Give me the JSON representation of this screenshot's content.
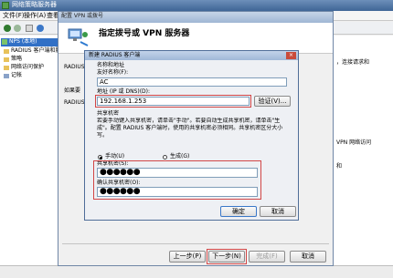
{
  "main_window": {
    "title": "网络策略服务器"
  },
  "menu": [
    "文件(F)",
    "操作(A)",
    "查看(V)"
  ],
  "tree": {
    "items": [
      {
        "label": "NPS (本地)"
      },
      {
        "label": "RADIUS 客户端和服务器"
      },
      {
        "label": "策略"
      },
      {
        "label": "网络访问保护"
      },
      {
        "label": "记帐"
      }
    ]
  },
  "left_snippets": [
    "RADIUS",
    "如果要",
    "RADIUS"
  ],
  "right_snippets": [
    "，连接请求和",
    "VPN 网络访问",
    "和"
  ],
  "wizard": {
    "title": "配置 VPN 或拨号",
    "heading": "指定拨号或 VPN 服务器",
    "back_label": "上一步(P)",
    "next_label": "下一步(N)",
    "finish_label": "完成(F)",
    "cancel_label": "取消"
  },
  "dialog": {
    "title": "新建 RADIUS 客户端",
    "group_name_address": "名称和地址",
    "friendly_name_label": "友好名称(F):",
    "friendly_name_value": "AC",
    "address_label": "地址 (IP 或 DNS)(D):",
    "address_value": "192.168.1.253",
    "verify_label": "验证(V)...",
    "group_shared_secret": "共享机密",
    "description": "若要手动键入共享机密，请单击\"手动\"。若要自动生成共享机密，请单击\"生成\"。配置 RADIUS 客户端时，使用的共享机密必须相同。共享机密区分大小写。",
    "radio_manual": "手动(U)",
    "radio_generate": "生成(G)",
    "shared_secret_label": "共享机密(S):",
    "shared_secret_value": "●●●●●●",
    "confirm_label": "确认共享机密(O):",
    "confirm_value": "●●●●●●",
    "ok_label": "确定",
    "cancel_label": "取消"
  }
}
